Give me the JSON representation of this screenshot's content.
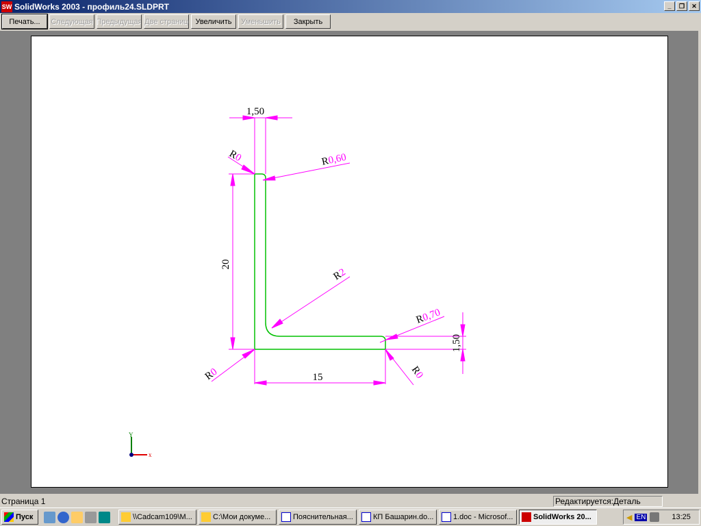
{
  "window": {
    "title": "SolidWorks 2003 - профиль24.SLDPRT",
    "logo": "SW"
  },
  "toolbar": {
    "print": "Печать...",
    "next": "Следующая",
    "prev": "Предыдущая",
    "two_pages": "Две страниц",
    "zoom_in": "Увеличить",
    "zoom_out": "Уменьшить",
    "close": "Закрыть"
  },
  "drawing": {
    "dim_top_thickness": "1,50",
    "dim_height": "20",
    "dim_width": "15",
    "dim_right_thickness": "1,50",
    "r_top_left": "R",
    "r_top_left_val": "0",
    "r_top": "R",
    "r_top_val": "0,60",
    "r_inner": "R",
    "r_inner_val": "2",
    "r_right": "R",
    "r_right_val": "0,70",
    "r_bottom_left": "R",
    "r_bottom_left_val": "0",
    "r_bottom_right": "R",
    "r_bottom_right_val": "0",
    "axis_x": "x",
    "axis_y": "Y"
  },
  "colors": {
    "profile": "#00c000",
    "dimension": "#ff00ff"
  },
  "status": {
    "page": "Страница 1",
    "mode": "Редактируется:Деталь"
  },
  "taskbar": {
    "start": "Пуск",
    "tasks": [
      "\\\\Cadcam109\\M...",
      "C:\\Мои докуме...",
      "Пояснительная...",
      "КП Башарин.do...",
      "1.doc - Microsof...",
      "SolidWorks 20..."
    ],
    "lang": "EN",
    "time": "13:25"
  }
}
